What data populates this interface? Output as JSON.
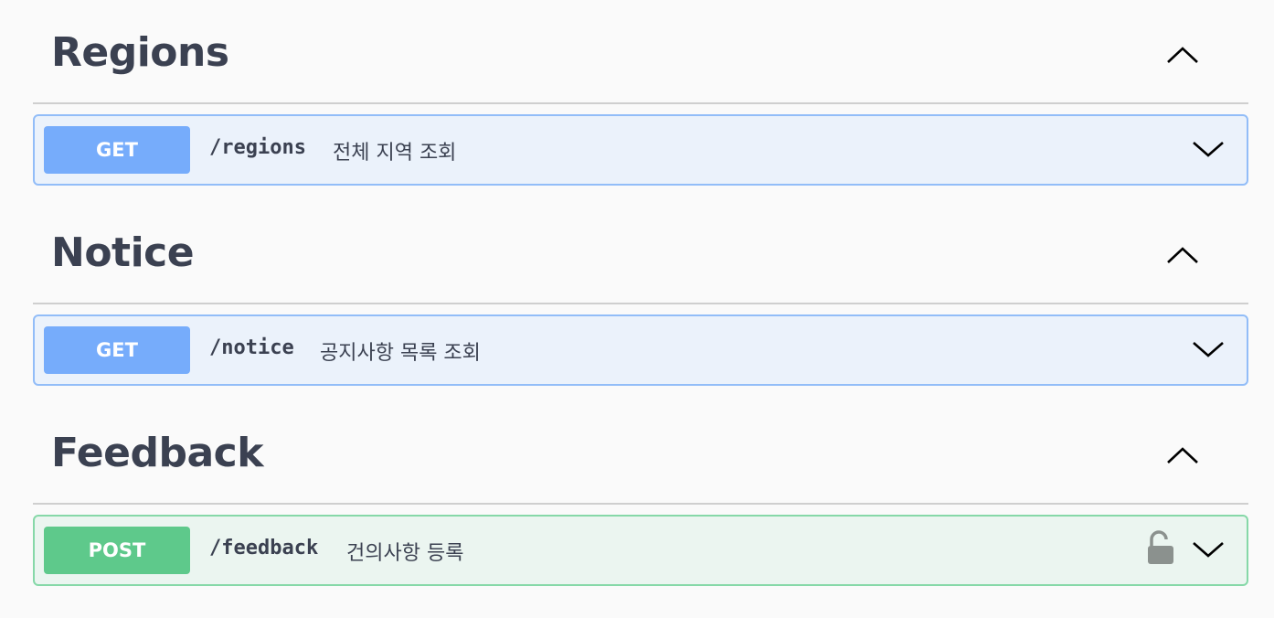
{
  "sections": [
    {
      "title": "Regions",
      "toggle_icon": "chevron-up-icon",
      "operations": [
        {
          "method": "GET",
          "path": "/regions",
          "summary": "전체 지역 조회",
          "expand_icon": "chevron-down-icon"
        }
      ]
    },
    {
      "title": "Notice",
      "toggle_icon": "chevron-up-icon",
      "operations": [
        {
          "method": "GET",
          "path": "/notice",
          "summary": "공지사항 목록 조회",
          "expand_icon": "chevron-down-icon"
        }
      ]
    },
    {
      "title": "Feedback",
      "toggle_icon": "chevron-up-icon",
      "operations": [
        {
          "method": "POST",
          "path": "/feedback",
          "summary": "건의사항 등록",
          "lock_icon": "unlock-icon",
          "expand_icon": "chevron-down-icon"
        }
      ]
    }
  ],
  "colors": {
    "get_bg": "#ebf2fb",
    "get_border": "#92bdf8",
    "get_method": "#76acfb",
    "post_bg": "#ebf5f0",
    "post_border": "#86d8a8",
    "post_method": "#5ec98b",
    "text": "#3b4151"
  }
}
